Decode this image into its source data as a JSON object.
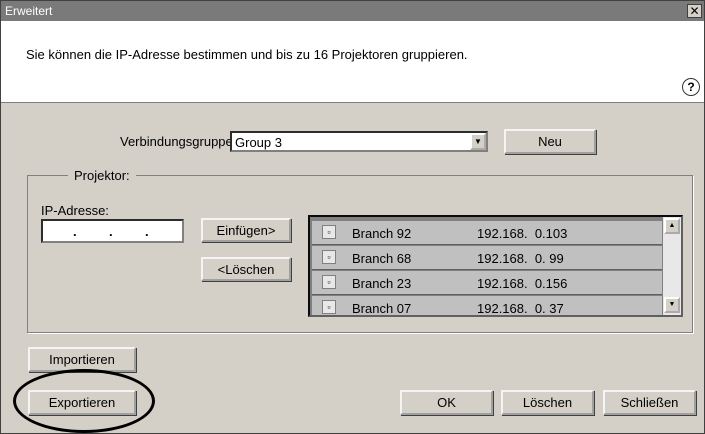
{
  "window": {
    "title": "Erweitert",
    "close_glyph": "✕"
  },
  "header": {
    "description": "Sie können die IP-Adresse bestimmen und bis zu 16 Projektoren gruppieren.",
    "help_glyph": "?"
  },
  "connection": {
    "label": "Verbindungsgruppe:",
    "value": "Group 3",
    "new_button": "Neu"
  },
  "projector": {
    "legend": "Projektor:",
    "ip_label": "IP-Adresse:",
    "ip_value": ". . .",
    "insert_button": "Einfügen>",
    "delete_button": "<Löschen",
    "rows": [
      {
        "name": "Branch 92",
        "ip": "192.168.  0.103"
      },
      {
        "name": "Branch 68",
        "ip": "192.168.  0. 99"
      },
      {
        "name": "Branch 23",
        "ip": "192.168.  0.156"
      },
      {
        "name": "Branch 07",
        "ip": "192.168.  0. 37"
      }
    ]
  },
  "footer": {
    "import_button": "Importieren",
    "export_button": "Exportieren",
    "ok_button": "OK",
    "delete_button": "Löschen",
    "close_button": "Schließen"
  },
  "icons": {
    "list_item": "projector-icon",
    "scroll_up": "scroll-up-icon",
    "scroll_down": "scroll-down-icon",
    "combo": "dropdown-arrow-icon"
  },
  "colors": {
    "dialog_bg": "#d4d0c8",
    "titlebar_bg": "#7a7a7a",
    "list_bg": "#808080",
    "row_bg": "#c0c0c0"
  }
}
